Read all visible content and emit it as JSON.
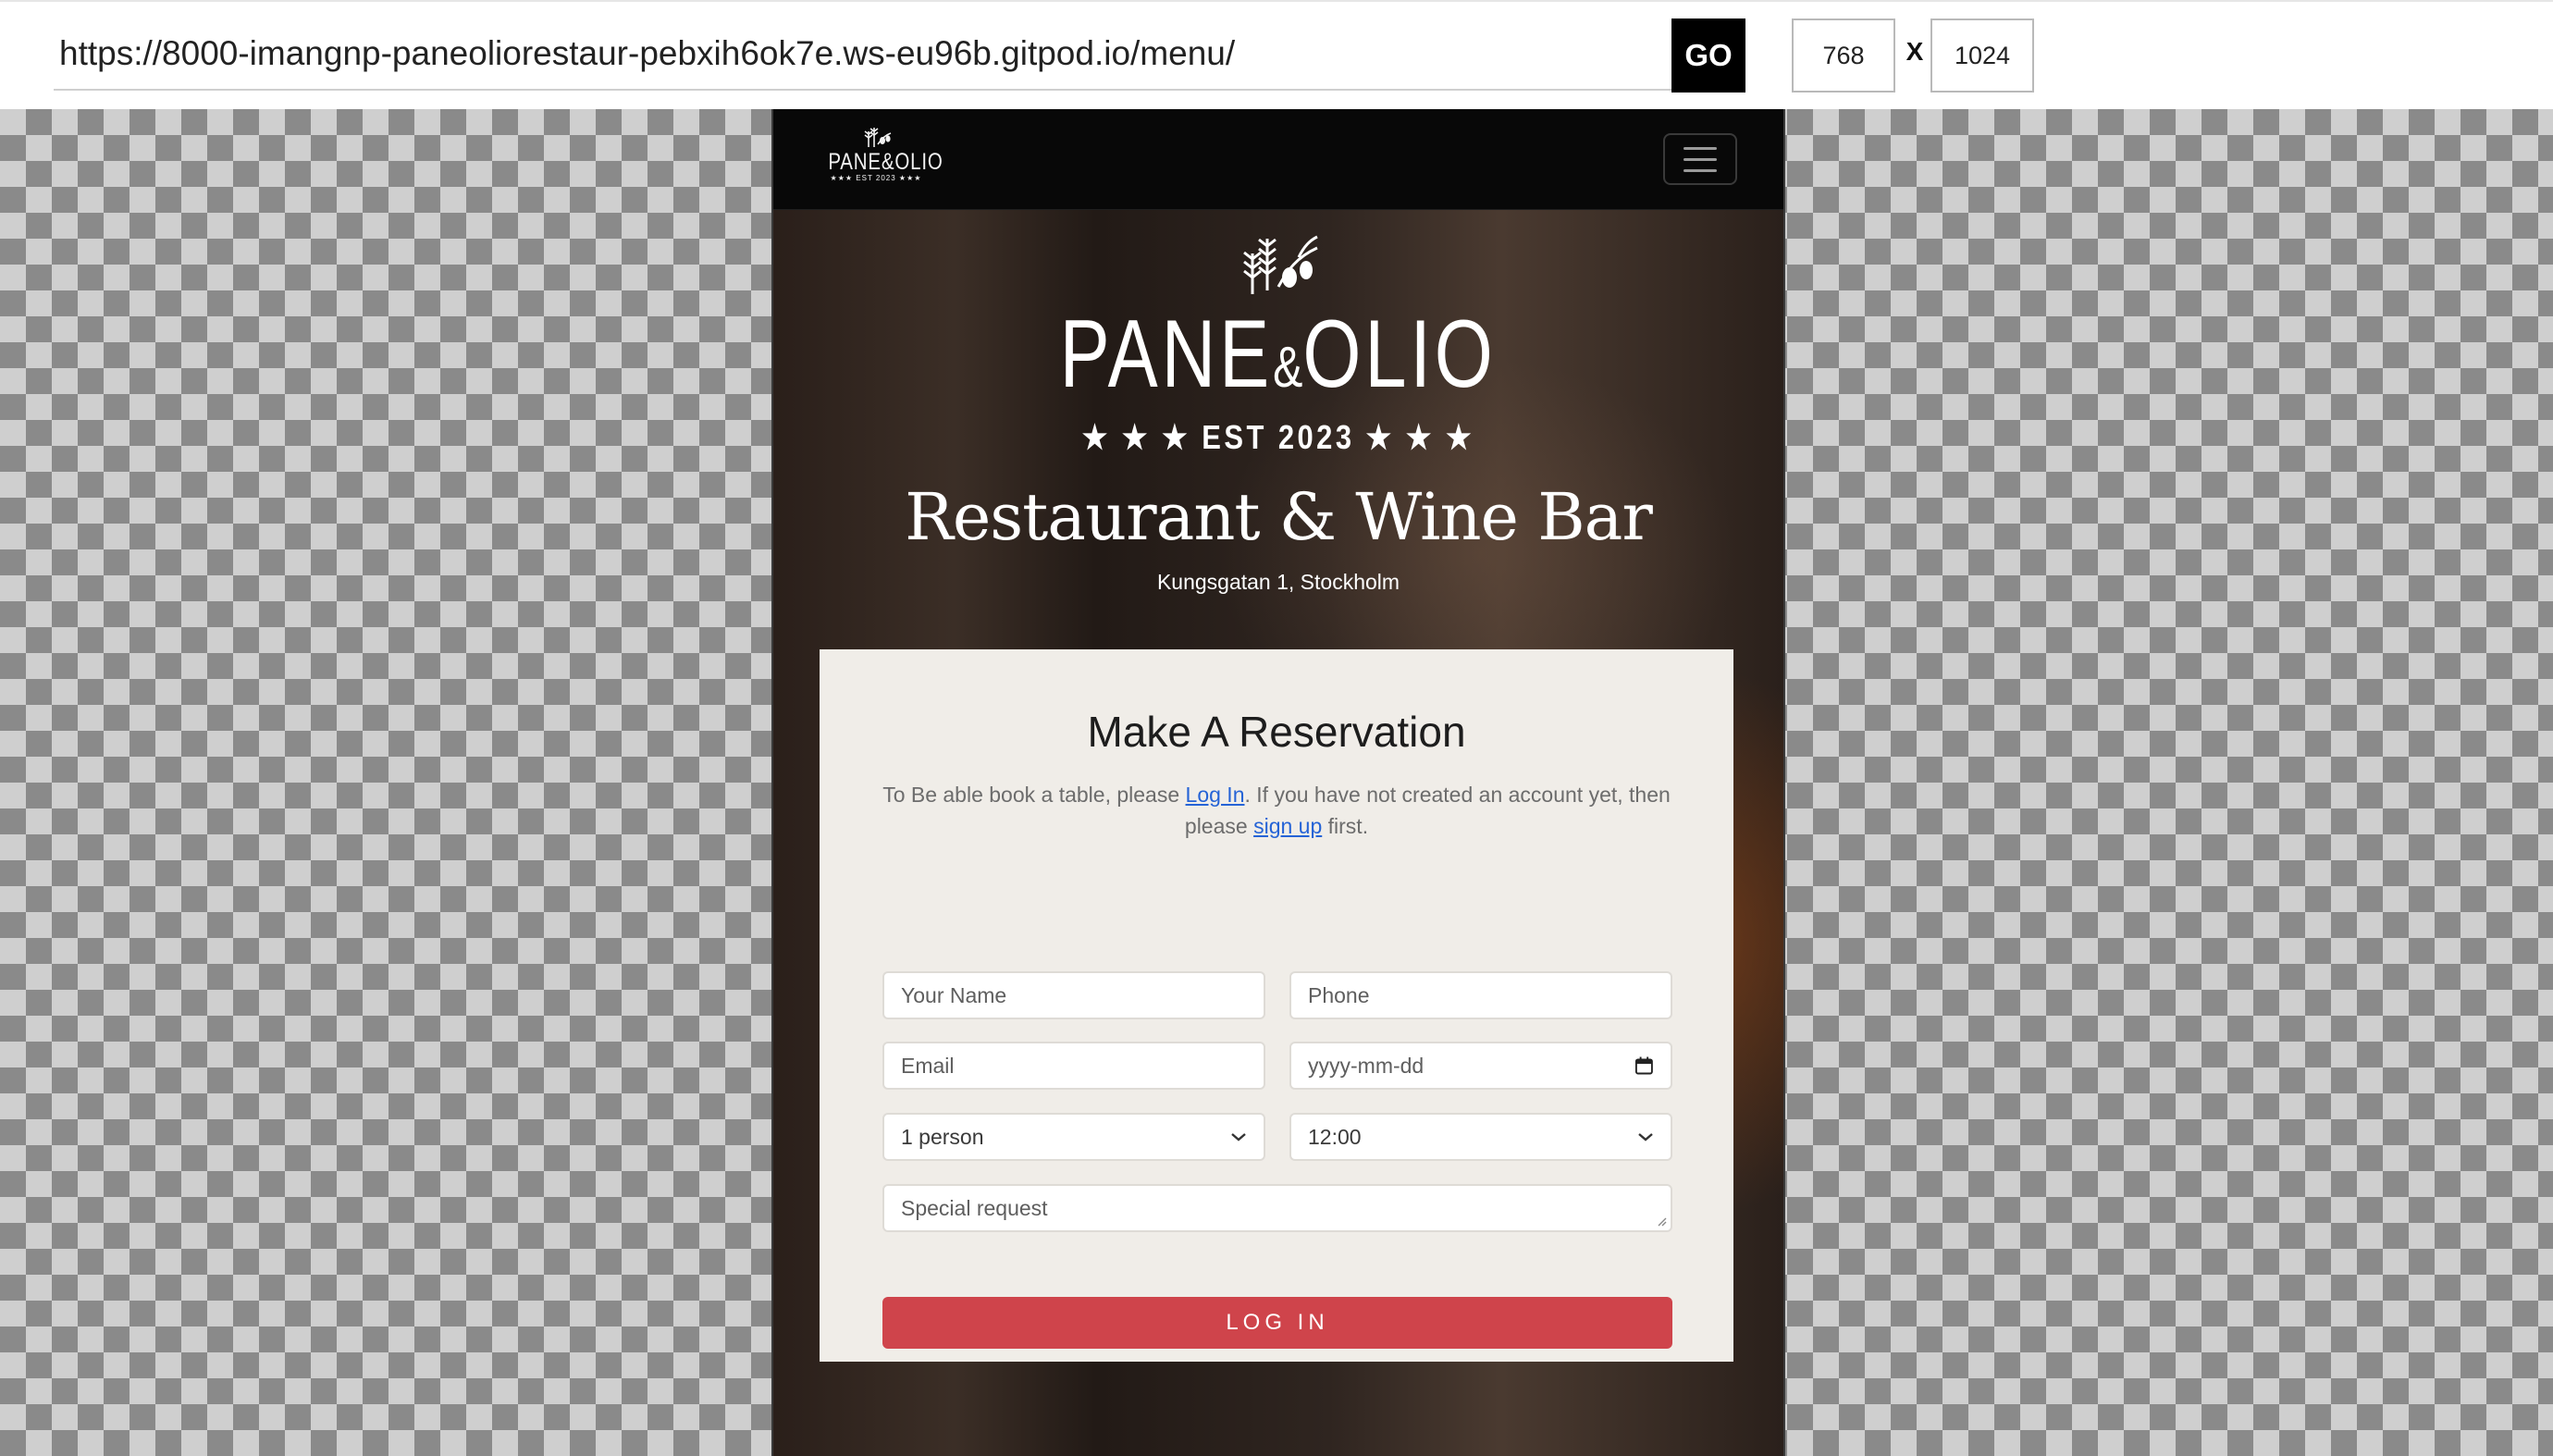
{
  "toolbar": {
    "url": "https://8000-imangnp-paneoliorestaur-pebxih6ok7e.ws-eu96b.gitpod.io/menu/",
    "go_label": "GO",
    "width_value": "768",
    "separator": "X",
    "height_value": "1024"
  },
  "navbar": {
    "logo_text": "PANE&OLIO",
    "logo_est": "★★★ EST 2023 ★★★"
  },
  "hero": {
    "brand_left": "PANE",
    "brand_amp": "&",
    "brand_right": "OLIO",
    "est": "★ ★ ★  EST 2023  ★ ★ ★",
    "title": "Restaurant & Wine Bar",
    "address": "Kungsgatan 1, Stockholm"
  },
  "reservation": {
    "title": "Make A Reservation",
    "note_prefix": "To Be able book a table, please ",
    "login_link": "Log In",
    "note_middle": ". If you have not created an account yet, then please ",
    "signup_link": "sign up",
    "note_suffix": " first.",
    "name_placeholder": "Your Name",
    "phone_placeholder": "Phone",
    "email_placeholder": "Email",
    "date_placeholder": "yyyy-mm-dd",
    "party_size_value": "1 person",
    "time_value": "12:00",
    "special_request_placeholder": "Special request",
    "submit_label": "LOG IN"
  },
  "colors": {
    "submit_button": "#cf444b",
    "card_background": "#f0ede8",
    "link": "#2563d6",
    "navbar": "#080808"
  }
}
